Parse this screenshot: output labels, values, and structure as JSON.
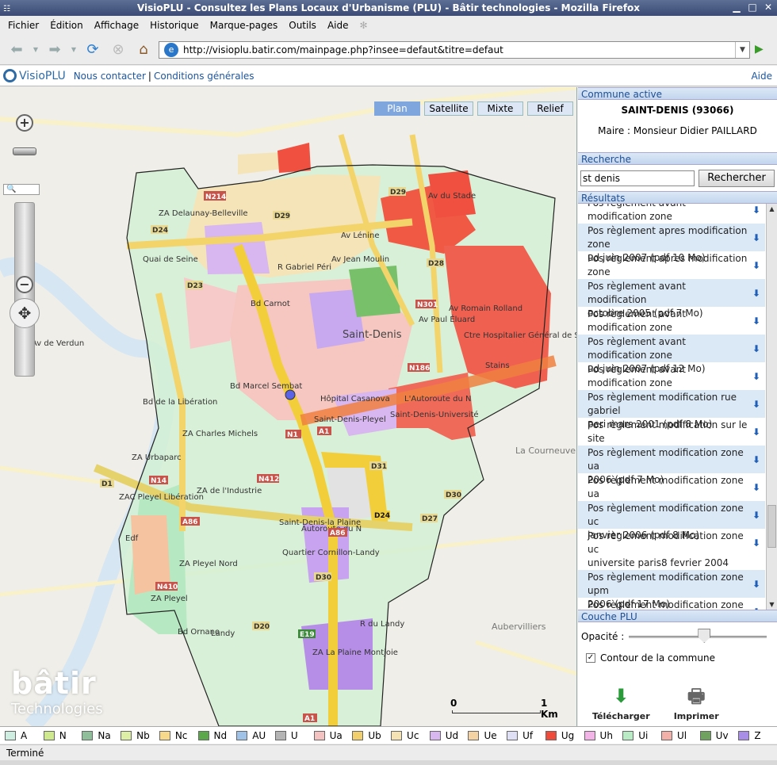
{
  "window": {
    "title": "VisioPLU - Consultez les Plans Locaux d'Urbanisme (PLU) - Bâtir technologies - Mozilla Firefox"
  },
  "menu": [
    "Fichier",
    "Édition",
    "Affichage",
    "Historique",
    "Marque-pages",
    "Outils",
    "Aide"
  ],
  "url": "http://visioplu.batir.com/mainpage.php?insee=defaut&titre=defaut",
  "site": {
    "logo": "VisioPLU",
    "contact": "Nous contacter",
    "separator": "|",
    "conditions": "Conditions générales",
    "aide": "Aide"
  },
  "map": {
    "types": [
      "Plan",
      "Satellite",
      "Mixte",
      "Relief"
    ],
    "active_type": "Plan",
    "scale": {
      "start": "0",
      "end": "1 Km"
    },
    "logo_main": "bâtir",
    "logo_sub": "Technologies",
    "labels": [
      "Saint-Denis",
      "Ctre Hospitalier Général de Saint-Denis",
      "Hôpital Casanova",
      "Saint-Denis-Pleyel",
      "Saint-Denis-Université",
      "Quartier Cornillon-Landy",
      "ZA Delaunay-Belleville",
      "ZA Charles Michels",
      "ZA Urbaparc",
      "ZAC Pleyel Libération",
      "ZA de l'Industrie",
      "ZA Pleyel Nord",
      "ZA Pleyel",
      "ZA La Plaine Montjoie",
      "Saint-Denis-la Plaine",
      "Bd de la Libération",
      "Quai de Seine",
      "Bd Carnot",
      "Av Lénine",
      "Av Romain Rolland",
      "Bd Marcel Sembat",
      "L'Autoroute du N",
      "Autoroute du N",
      "Av du Stade",
      "Stains",
      "Av de Verdun",
      "Edf",
      "Bd Ornano",
      "Landy",
      "R du Landy",
      "Aubervilliers",
      "La Courneuve",
      "Av Jean Moulin",
      "R Gabriel Péri",
      "Av Paul Éluard"
    ],
    "roads": [
      "N214",
      "D24",
      "D23",
      "D29",
      "D28",
      "N301",
      "N186",
      "N1",
      "A1",
      "D31",
      "D30",
      "D24",
      "D27",
      "N412",
      "N14",
      "A86",
      "A86",
      "N410",
      "D20",
      "E19",
      "A1",
      "D1",
      "D29",
      "D30"
    ]
  },
  "panel": {
    "commune_header": "Commune active",
    "commune_name": "SAINT-DENIS (93066)",
    "maire": "Maire : Monsieur Didier PAILLARD",
    "recherche_header": "Recherche",
    "search_value": "st denis",
    "search_button": "Rechercher",
    "results_header": "Résultats",
    "results": [
      {
        "l1": "Pos règlement avant modification zone",
        "l2": "uc juin 2007 (pdf 6 Mo)"
      },
      {
        "l1": "Pos règlement apres modification zone",
        "l2": "ud juin 2007 (pdf 10 Mo)"
      },
      {
        "l1": "Pos règlement apres modification zone",
        "l2": "ug novembre 2005 (pdf 7 Mo)"
      },
      {
        "l1": "Pos règlement avant modification",
        "l2": "octobre 2005 (pdf 7 Mo)"
      },
      {
        "l1": "Pos règlement avant modification zone",
        "l2": "uc juin 2007 (pdf 6 Mo)"
      },
      {
        "l1": "Pos règlement avant modification zone",
        "l2": "ud juin 2007 (pdf 12 Mo)"
      },
      {
        "l1": "Pos règlement avant modification zone",
        "l2": "ug novembre 2005 (pdf 6 Mo)"
      },
      {
        "l1": "Pos règlement modification rue gabriel",
        "l2": "peri mars 2001 (pdf 8 Mo)"
      },
      {
        "l1": "Pos règlement modification sur le site",
        "l2": "de l'iufm janvier 2006 (pdf 8 Mo)"
      },
      {
        "l1": "Pos règlement modification zone ua",
        "l2": "2006 (pdf 7 Mo)"
      },
      {
        "l1": "Pos règlement modification zone ua",
        "l2": "janvier 2006 (pdf 7 Mo)"
      },
      {
        "l1": "Pos règlement modification zone uc",
        "l2": "janvier 2006 (pdf 8 Mo)"
      },
      {
        "l1": "Pos règlement modification zone uc",
        "l2": "universite paris8 fevrier 2004 (pdf 10",
        "l3": "Mo)"
      },
      {
        "l1": "Pos règlement modification zone upm",
        "l2": "2006 (pdf 17 Mo)"
      },
      {
        "l1": "Pos règlement modification zone upm",
        "l2": ""
      }
    ],
    "couche_header": "Couche PLU",
    "opacity_label": "Opacité :",
    "opacity_value": 0.55,
    "contour_label": "Contour de la commune",
    "contour_checked": true,
    "telecharger": "Télécharger",
    "imprimer": "Imprimer"
  },
  "legend": [
    {
      "code": "A",
      "color": "#cdeee0"
    },
    {
      "code": "N",
      "color": "#cfe98f"
    },
    {
      "code": "Na",
      "color": "#8fbf9a"
    },
    {
      "code": "Nb",
      "color": "#dcefa5"
    },
    {
      "code": "Nc",
      "color": "#f6d98a"
    },
    {
      "code": "Nd",
      "color": "#5aa84a"
    },
    {
      "code": "AU",
      "color": "#9fc2e8"
    },
    {
      "code": "U",
      "color": "#b4b4b4"
    },
    {
      "code": "Ua",
      "color": "#f5c2c2"
    },
    {
      "code": "Ub",
      "color": "#f2cf6a"
    },
    {
      "code": "Uc",
      "color": "#f4e2b4"
    },
    {
      "code": "Ud",
      "color": "#d8b6ef"
    },
    {
      "code": "Ue",
      "color": "#f5d2a2"
    },
    {
      "code": "Uf",
      "color": "#dfe0f5"
    },
    {
      "code": "Ug",
      "color": "#f04a3a"
    },
    {
      "code": "Uh",
      "color": "#f2b4e6"
    },
    {
      "code": "Ui",
      "color": "#b9ebc4"
    },
    {
      "code": "Ul",
      "color": "#f2b0a8"
    },
    {
      "code": "Uv",
      "color": "#6fa15f"
    },
    {
      "code": "Z",
      "color": "#a98ee8"
    }
  ],
  "status": "Terminé"
}
